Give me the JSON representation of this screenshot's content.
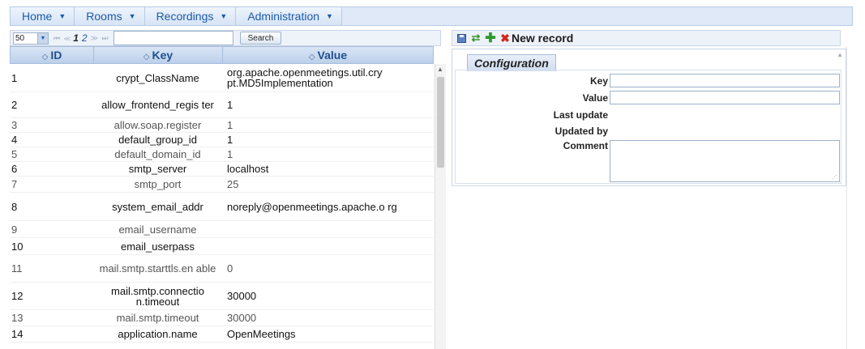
{
  "menu": [
    {
      "label": "Home"
    },
    {
      "label": "Rooms"
    },
    {
      "label": "Recordings"
    },
    {
      "label": "Administration"
    }
  ],
  "grid_toolbar": {
    "page_size": "50",
    "pages": [
      "1",
      "2"
    ],
    "current_page": "1",
    "search_value": "",
    "search_label": "Search"
  },
  "grid": {
    "columns": [
      "ID",
      "Key",
      "Value"
    ],
    "rows": [
      {
        "id": "1",
        "key": "crypt_ClassName",
        "value": "org.apache.openmeetings.util.cry pt.MD5Implementation"
      },
      {
        "id": "2",
        "key": "allow_frontend_regis ter",
        "value": "1"
      },
      {
        "id": "3",
        "key": "allow.soap.register",
        "value": "1"
      },
      {
        "id": "4",
        "key": "default_group_id",
        "value": "1"
      },
      {
        "id": "5",
        "key": "default_domain_id",
        "value": "1"
      },
      {
        "id": "6",
        "key": "smtp_server",
        "value": "localhost"
      },
      {
        "id": "7",
        "key": "smtp_port",
        "value": "25"
      },
      {
        "id": "8",
        "key": "system_email_addr",
        "value": "noreply@openmeetings.apache.o rg"
      },
      {
        "id": "9",
        "key": "email_username",
        "value": ""
      },
      {
        "id": "10",
        "key": "email_userpass",
        "value": ""
      },
      {
        "id": "11",
        "key": "mail.smtp.starttls.en able",
        "value": "0"
      },
      {
        "id": "12",
        "key": "mail.smtp.connectio n.timeout",
        "value": "30000"
      },
      {
        "id": "13",
        "key": "mail.smtp.timeout",
        "value": "30000"
      },
      {
        "id": "14",
        "key": "application.name",
        "value": "OpenMeetings"
      }
    ]
  },
  "form_toolbar": {
    "new_record_label": "New record",
    "icons": [
      "save-icon",
      "refresh-icon",
      "add-icon",
      "delete-icon"
    ]
  },
  "form": {
    "tab_label": "Configuration",
    "key_label": "Key",
    "value_label": "Value",
    "last_update_label": "Last update",
    "updated_by_label": "Updated by",
    "comment_label": "Comment",
    "key_value": "",
    "value_value": "",
    "comment_value": ""
  },
  "colors": {
    "menu_text": "#1d5aa8",
    "header_bg": "#bcd0ea",
    "accent_green": "#2e9a2a",
    "accent_red": "#d02a20"
  }
}
